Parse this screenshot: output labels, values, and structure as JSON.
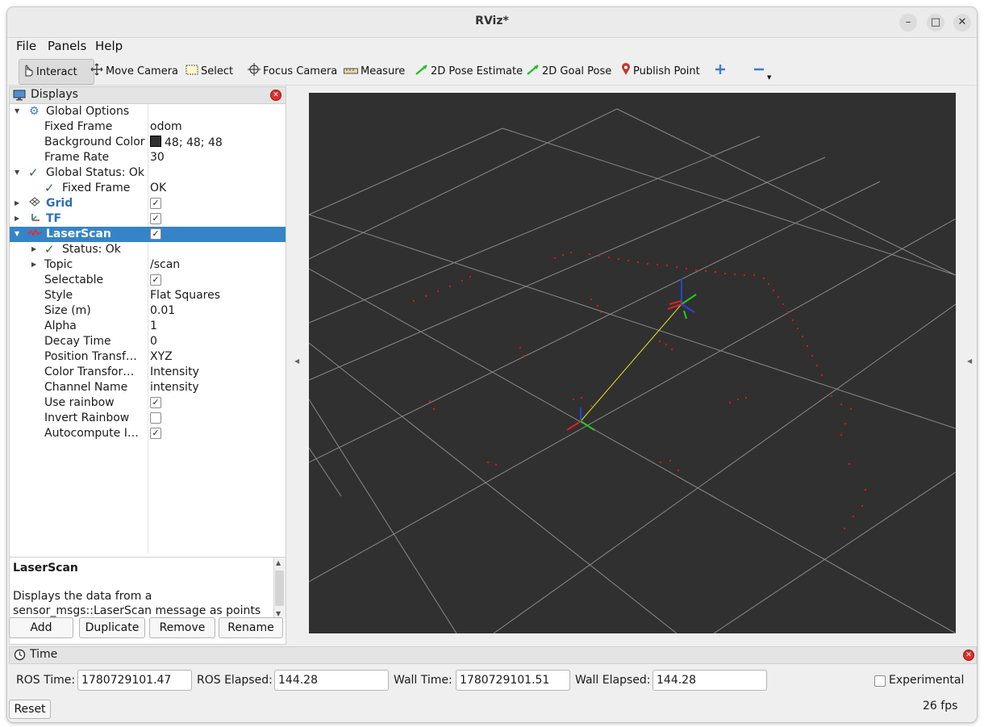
{
  "window": {
    "title": "RViz*"
  },
  "menu": {
    "file": "File",
    "panels": "Panels",
    "help": "Help"
  },
  "toolbar": {
    "interact": "Interact",
    "move_camera": "Move Camera",
    "select": "Select",
    "focus_camera": "Focus Camera",
    "measure": "Measure",
    "pose_estimate": "2D Pose Estimate",
    "goal_pose": "2D Goal Pose",
    "publish_point": "Publish Point"
  },
  "displays": {
    "title": "Displays",
    "global_options": "Global Options",
    "fixed_frame_label": "Fixed Frame",
    "fixed_frame_value": "odom",
    "bg_color_label": "Background Color",
    "bg_color_value": "48; 48; 48",
    "bg_color_hex": "#303030",
    "frame_rate_label": "Frame Rate",
    "frame_rate_value": "30",
    "global_status": "Global Status: Ok",
    "gs_fixed_frame_label": "Fixed Frame",
    "gs_fixed_frame_value": "OK",
    "grid": "Grid",
    "tf": "TF",
    "laserscan": "LaserScan",
    "status_ok": "Status: Ok",
    "topic_label": "Topic",
    "topic_value": "/scan",
    "selectable_label": "Selectable",
    "style_label": "Style",
    "style_value": "Flat Squares",
    "size_label": "Size (m)",
    "size_value": "0.01",
    "alpha_label": "Alpha",
    "alpha_value": "1",
    "decay_label": "Decay Time",
    "decay_value": "0",
    "position_label": "Position Transf…",
    "position_value": "XYZ",
    "color_label": "Color Transfor…",
    "color_value": "Intensity",
    "channel_label": "Channel Name",
    "channel_value": "intensity",
    "rainbow_label": "Use rainbow",
    "invert_label": "Invert Rainbow",
    "autocompute_label": "Autocompute I…"
  },
  "description": {
    "heading": "LaserScan",
    "body": "Displays the data from a sensor_msgs::LaserScan message as points in the world, drawn as points, billboards"
  },
  "buttons": {
    "add": "Add",
    "duplicate": "Duplicate",
    "remove": "Remove",
    "rename": "Rename"
  },
  "time": {
    "title": "Time",
    "ros_time_label": "ROS Time:",
    "ros_time": "1780729101.47",
    "ros_elapsed_label": "ROS Elapsed:",
    "ros_elapsed": "144.28",
    "wall_time_label": "Wall Time:",
    "wall_time": "1780729101.51",
    "wall_elapsed_label": "Wall Elapsed:",
    "wall_elapsed": "144.28",
    "experimental": "Experimental",
    "reset": "Reset",
    "fps": "26 fps"
  },
  "colors": {
    "selection": "#3584c8",
    "scan": "#d11a1a",
    "viewport_bg": "#303030"
  }
}
